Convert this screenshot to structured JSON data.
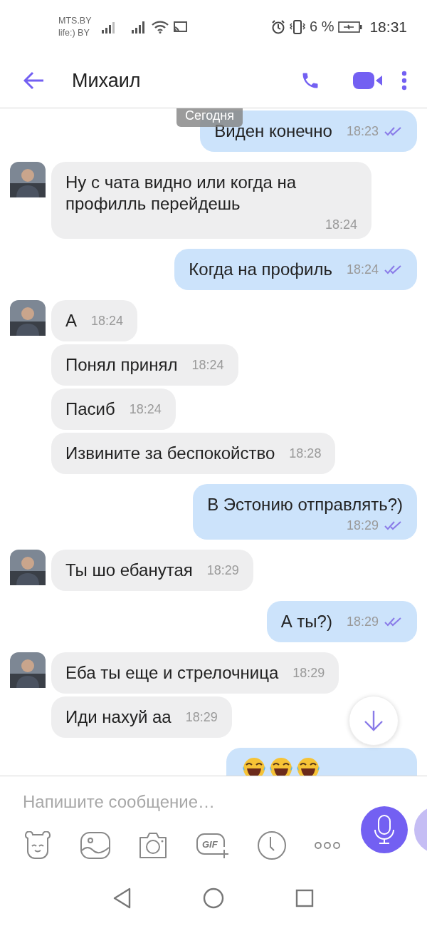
{
  "status_bar": {
    "carriers": [
      "MTS.BY",
      "life:) BY"
    ],
    "battery_percent": "6 %",
    "time": "18:31"
  },
  "header": {
    "title": "Михаил"
  },
  "date_label": "Сегодня",
  "groups": [
    {
      "kind": "outgoing",
      "messages": [
        {
          "text": "Виден конечно",
          "time": "18:23",
          "read": true,
          "time_below": false
        }
      ]
    },
    {
      "kind": "incoming",
      "messages": [
        {
          "text": "Ну с чата видно или когда на профилль перейдешь",
          "time": "18:24",
          "time_below": true
        }
      ]
    },
    {
      "kind": "outgoing",
      "messages": [
        {
          "text": "Когда на профиль",
          "time": "18:24",
          "read": true,
          "time_below": false
        }
      ]
    },
    {
      "kind": "incoming",
      "messages": [
        {
          "text": "А",
          "time": "18:24",
          "time_below": false
        },
        {
          "text": "Понял принял",
          "time": "18:24",
          "time_below": false
        },
        {
          "text": "Пасиб",
          "time": "18:24",
          "time_below": false
        },
        {
          "text": "Извините за беспокойство",
          "time": "18:28",
          "time_below": false
        }
      ]
    },
    {
      "kind": "outgoing",
      "messages": [
        {
          "text": "В Эстонию отправлять?)",
          "time": "18:29",
          "read": true,
          "time_below": true
        }
      ]
    },
    {
      "kind": "incoming",
      "messages": [
        {
          "text": "Ты шо ебанутая",
          "time": "18:29",
          "time_below": false
        }
      ]
    },
    {
      "kind": "outgoing",
      "messages": [
        {
          "text": "А ты?)",
          "time": "18:29",
          "read": true,
          "time_below": false
        }
      ]
    },
    {
      "kind": "incoming",
      "messages": [
        {
          "text": "Еба ты еще и стрелочница",
          "time": "18:29",
          "time_below": false
        },
        {
          "text": "Иди нахуй аа",
          "time": "18:29",
          "time_below": false
        }
      ]
    },
    {
      "kind": "outgoing",
      "messages": [
        {
          "kind": "emoji",
          "emojis": [
            {
              "kind": "tears-of-joy"
            },
            {
              "kind": "tears-of-joy"
            },
            {
              "kind": "tears-of-joy"
            }
          ]
        }
      ]
    }
  ],
  "composer": {
    "placeholder": "Напишите сообщение…",
    "gif_label": "GIF"
  }
}
